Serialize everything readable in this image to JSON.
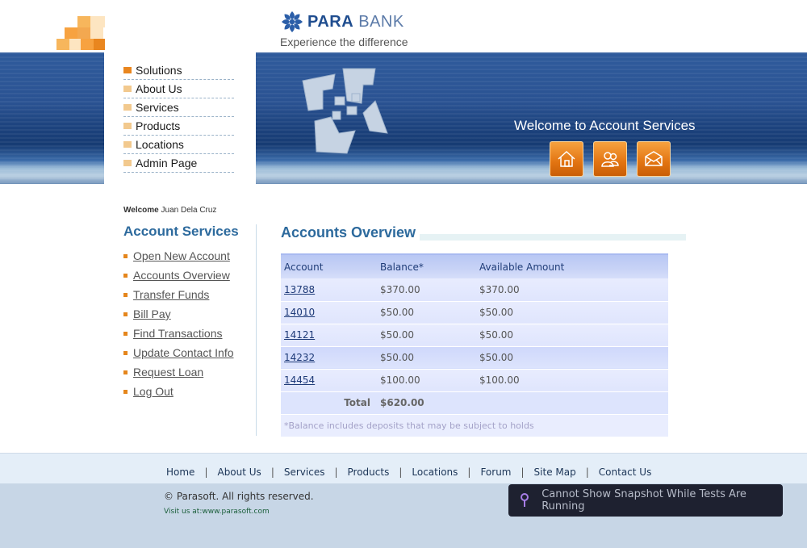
{
  "header": {
    "brand_bold": "PARA",
    "brand_light": "BANK",
    "caption": "Experience the difference",
    "logo_colors": [
      "#f7a240",
      "#fbd39a",
      "#e9861f",
      "#fde5c1"
    ]
  },
  "nav": {
    "items": [
      "Solutions",
      "About Us",
      "Services",
      "Products",
      "Locations",
      "Admin Page"
    ]
  },
  "banner": {
    "title": "Welcome to Account Services",
    "buttons": [
      {
        "icon": "home-icon"
      },
      {
        "icon": "about-icon"
      },
      {
        "icon": "contact-icon"
      }
    ]
  },
  "sidebar": {
    "welcome_label": "Welcome",
    "user_name": "Juan Dela Cruz",
    "title": "Account Services",
    "links": [
      "Open New Account",
      "Accounts Overview",
      "Transfer Funds",
      "Bill Pay",
      "Find Transactions",
      "Update Contact Info",
      "Request Loan",
      "Log Out"
    ]
  },
  "main": {
    "title": "Accounts Overview",
    "columns": [
      "Account",
      "Balance*",
      "Available Amount"
    ],
    "rows": [
      {
        "account": "13788",
        "balance": "$370.00",
        "available": "$370.00"
      },
      {
        "account": "14010",
        "balance": "$50.00",
        "available": "$50.00"
      },
      {
        "account": "14121",
        "balance": "$50.00",
        "available": "$50.00"
      },
      {
        "account": "14232",
        "balance": "$50.00",
        "available": "$50.00"
      },
      {
        "account": "14454",
        "balance": "$100.00",
        "available": "$100.00"
      }
    ],
    "total_label": "Total",
    "total_value": "$620.00",
    "note": "*Balance includes deposits that may be subject to holds"
  },
  "footer": {
    "links": [
      "Home",
      "About Us",
      "Services",
      "Products",
      "Locations",
      "Forum",
      "Site Map",
      "Contact Us"
    ],
    "copyright": "© Parasoft. All rights reserved.",
    "visit_prefix": "Visit us at:",
    "visit_url": "www.parasoft.com"
  },
  "toast": {
    "icon": "pin-icon",
    "text": "Cannot Show Snapshot While Tests Are Running"
  }
}
